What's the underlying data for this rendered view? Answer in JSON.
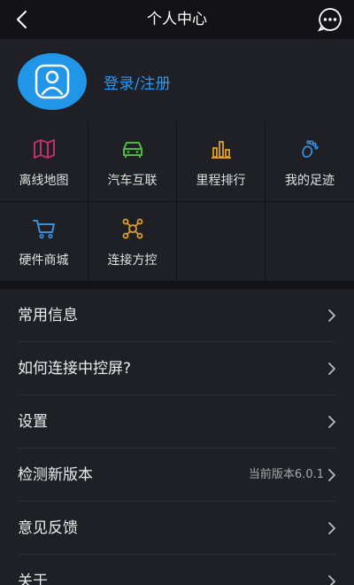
{
  "header": {
    "title": "个人中心",
    "back_icon": "chevron-left-icon",
    "more_icon": "chat-more-icon"
  },
  "profile": {
    "avatar_icon": "user-avatar-icon",
    "login_label": "登录/注册",
    "accent_color": "#2196e8"
  },
  "grid": {
    "items": [
      {
        "label": "离线地图",
        "icon": "map-icon",
        "color": "#c0306a"
      },
      {
        "label": "汽车互联",
        "icon": "car-icon",
        "color": "#4fb845"
      },
      {
        "label": "里程排行",
        "icon": "bar-chart-icon",
        "color": "#e0a020"
      },
      {
        "label": "我的足迹",
        "icon": "footprint-icon",
        "color": "#3a8fd8"
      },
      {
        "label": "硬件商城",
        "icon": "cart-icon",
        "color": "#3a8fd8"
      },
      {
        "label": "连接方控",
        "icon": "remote-control-icon",
        "color": "#e0a020"
      }
    ]
  },
  "list": {
    "items": [
      {
        "label": "常用信息",
        "value": ""
      },
      {
        "label": "如何连接中控屏?",
        "value": ""
      },
      {
        "label": "设置",
        "value": ""
      },
      {
        "label": "检测新版本",
        "value": "当前版本6.0.1"
      },
      {
        "label": "意见反馈",
        "value": ""
      },
      {
        "label": "关于",
        "value": ""
      }
    ]
  }
}
